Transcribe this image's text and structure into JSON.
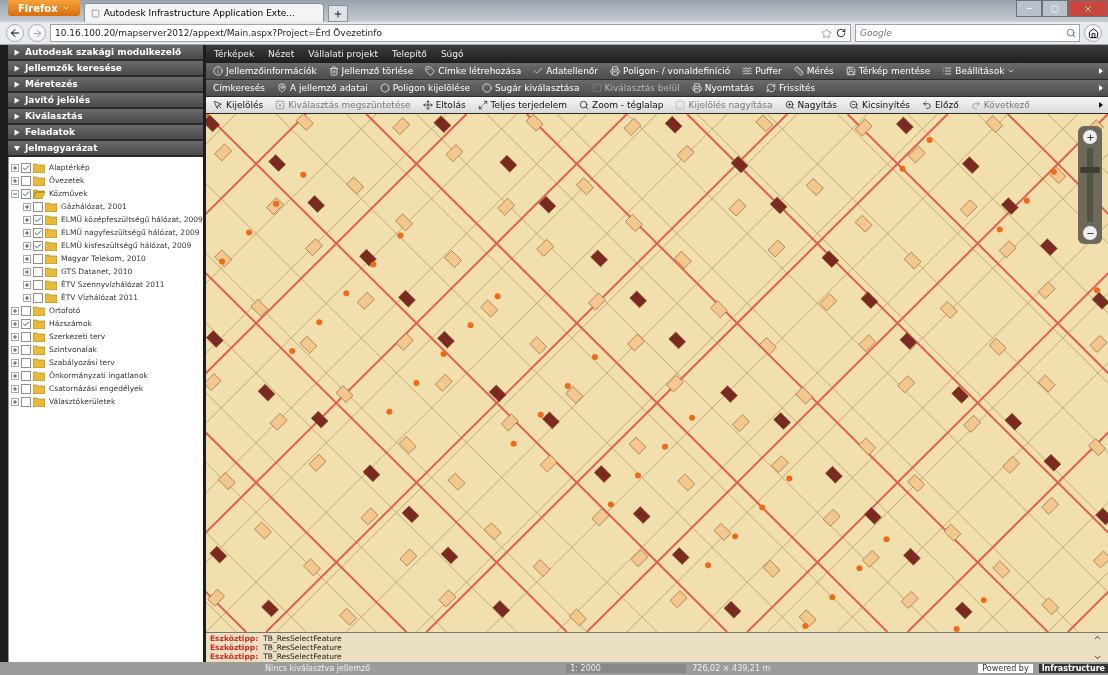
{
  "browser": {
    "menu_button": "Firefox",
    "tabs": [
      {
        "title": "Autodesk Infrastructure Application Exte...",
        "selected": true
      }
    ],
    "url": "10.16.100.20/mapserver2012/appext/Main.aspx?Project=Érd Övezetinfo",
    "search": {
      "placeholder": "Google"
    }
  },
  "sidebar": {
    "sections": [
      {
        "title": "Autodesk szakági modulkezelő",
        "expanded": false
      },
      {
        "title": "Jellemzők keresése",
        "expanded": false
      },
      {
        "title": "Méretezés",
        "expanded": false
      },
      {
        "title": "Javító jelölés",
        "expanded": false
      },
      {
        "title": "Kiválasztás",
        "expanded": false
      },
      {
        "title": "Feladatok",
        "expanded": false
      },
      {
        "title": "Jelmagyarázat",
        "expanded": true
      }
    ],
    "legend": [
      {
        "label": "Alaptérkép",
        "checked": true,
        "expanded": false
      },
      {
        "label": "Övezetek",
        "checked": false,
        "expanded": false
      },
      {
        "label": "Közművek",
        "checked": true,
        "expanded": true,
        "children": [
          {
            "label": "Gázhálózat, 2001",
            "checked": false,
            "expanded": false
          },
          {
            "label": "ELMÜ középfeszültségű hálózat, 2009",
            "checked": true,
            "expanded": false
          },
          {
            "label": "ELMÜ nagyfeszültségű hálózat, 2009",
            "checked": true,
            "expanded": false
          },
          {
            "label": "ELMÜ kisfeszültségű hálózat, 2009",
            "checked": true,
            "expanded": false
          },
          {
            "label": "Magyar Telekom, 2010",
            "checked": false,
            "expanded": false
          },
          {
            "label": "GTS Datanet, 2010",
            "checked": false,
            "expanded": false
          },
          {
            "label": "ÉTV Szennyvízhálózat 2011",
            "checked": false,
            "expanded": false
          },
          {
            "label": "ÉTV Vízhálózat 2011",
            "checked": false,
            "expanded": false
          }
        ]
      },
      {
        "label": "Ortofotó",
        "checked": false,
        "expanded": false
      },
      {
        "label": "Házszámok",
        "checked": true,
        "expanded": false
      },
      {
        "label": "Szerkezeti terv",
        "checked": false,
        "expanded": false
      },
      {
        "label": "Szintvonalak",
        "checked": false,
        "expanded": false
      },
      {
        "label": "Szabályozási terv",
        "checked": false,
        "expanded": false
      },
      {
        "label": "Önkormányzati ingatlanok",
        "checked": false,
        "expanded": false
      },
      {
        "label": "Csatornázási engedélyek",
        "checked": false,
        "expanded": false
      },
      {
        "label": "Választókerületek",
        "checked": false,
        "expanded": false
      }
    ]
  },
  "zoom": {
    "level": 0.7
  },
  "menu_bar": [
    "Térképek",
    "Nézet",
    "Vállalati projekt",
    "Telepítő",
    "Súgó"
  ],
  "toolbars": [
    [
      {
        "label": "Jellemzőinformációk",
        "disabled": false,
        "dropdown": false
      },
      {
        "label": "Jellemző törlése",
        "disabled": false,
        "dropdown": false
      },
      {
        "label": "Címke létrehozása",
        "disabled": false,
        "dropdown": false
      },
      {
        "label": "Adatellenőr",
        "disabled": false,
        "dropdown": false
      },
      {
        "label": "Poligon- / vonaldefiníció",
        "disabled": false,
        "dropdown": false
      },
      {
        "label": "Puffer",
        "disabled": false,
        "dropdown": false
      },
      {
        "label": "Mérés",
        "disabled": false,
        "dropdown": false
      },
      {
        "label": "Térkép mentése",
        "disabled": false,
        "dropdown": false
      },
      {
        "label": "Beállítások",
        "disabled": false,
        "dropdown": true
      }
    ],
    [
      {
        "label": "Címkeresés",
        "disabled": false,
        "dropdown": false
      },
      {
        "label": "A jellemző adatai",
        "disabled": false,
        "dropdown": false
      },
      {
        "label": "Poligon kijelölése",
        "disabled": false,
        "dropdown": false
      },
      {
        "label": "Sugár kiválasztása",
        "disabled": false,
        "dropdown": false
      },
      {
        "label": "Kiválasztás belül",
        "disabled": true,
        "dropdown": false
      },
      {
        "label": "Nyomtatás",
        "disabled": false,
        "dropdown": false
      },
      {
        "label": "Frissítés",
        "disabled": false,
        "dropdown": false
      }
    ],
    [
      {
        "label": "Kijelölés",
        "disabled": false,
        "dropdown": false
      },
      {
        "label": "Kiválasztás megszüntetése",
        "disabled": true,
        "dropdown": false
      },
      {
        "label": "Eltolás",
        "disabled": false,
        "dropdown": false
      },
      {
        "label": "Teljes terjedelem",
        "disabled": false,
        "dropdown": false
      },
      {
        "label": "Zoom - téglalap",
        "disabled": false,
        "dropdown": false
      },
      {
        "label": "Kijelölés nagyítása",
        "disabled": true,
        "dropdown": false
      },
      {
        "label": "Nagyítás",
        "disabled": false,
        "dropdown": false
      },
      {
        "label": "Kicsinyítés",
        "disabled": false,
        "dropdown": false
      },
      {
        "label": "Előző",
        "disabled": false,
        "dropdown": false
      },
      {
        "label": "Következő",
        "disabled": true,
        "dropdown": false
      }
    ]
  ],
  "log": [
    {
      "label": "Eszköztipp:",
      "message": "TB_ResSelectFeature"
    },
    {
      "label": "Eszköztipp:",
      "message": "TB_ResSelectFeature"
    },
    {
      "label": "Eszköztipp:",
      "message": "TB_ResSelectFeature"
    }
  ],
  "status_bar": {
    "selection": "Nincs kiválasztva jellemző",
    "scale": "1: 2000",
    "extent": "726,02 × 439,21 m",
    "powered_by": "Powered by",
    "brand": "Infrastructure"
  }
}
